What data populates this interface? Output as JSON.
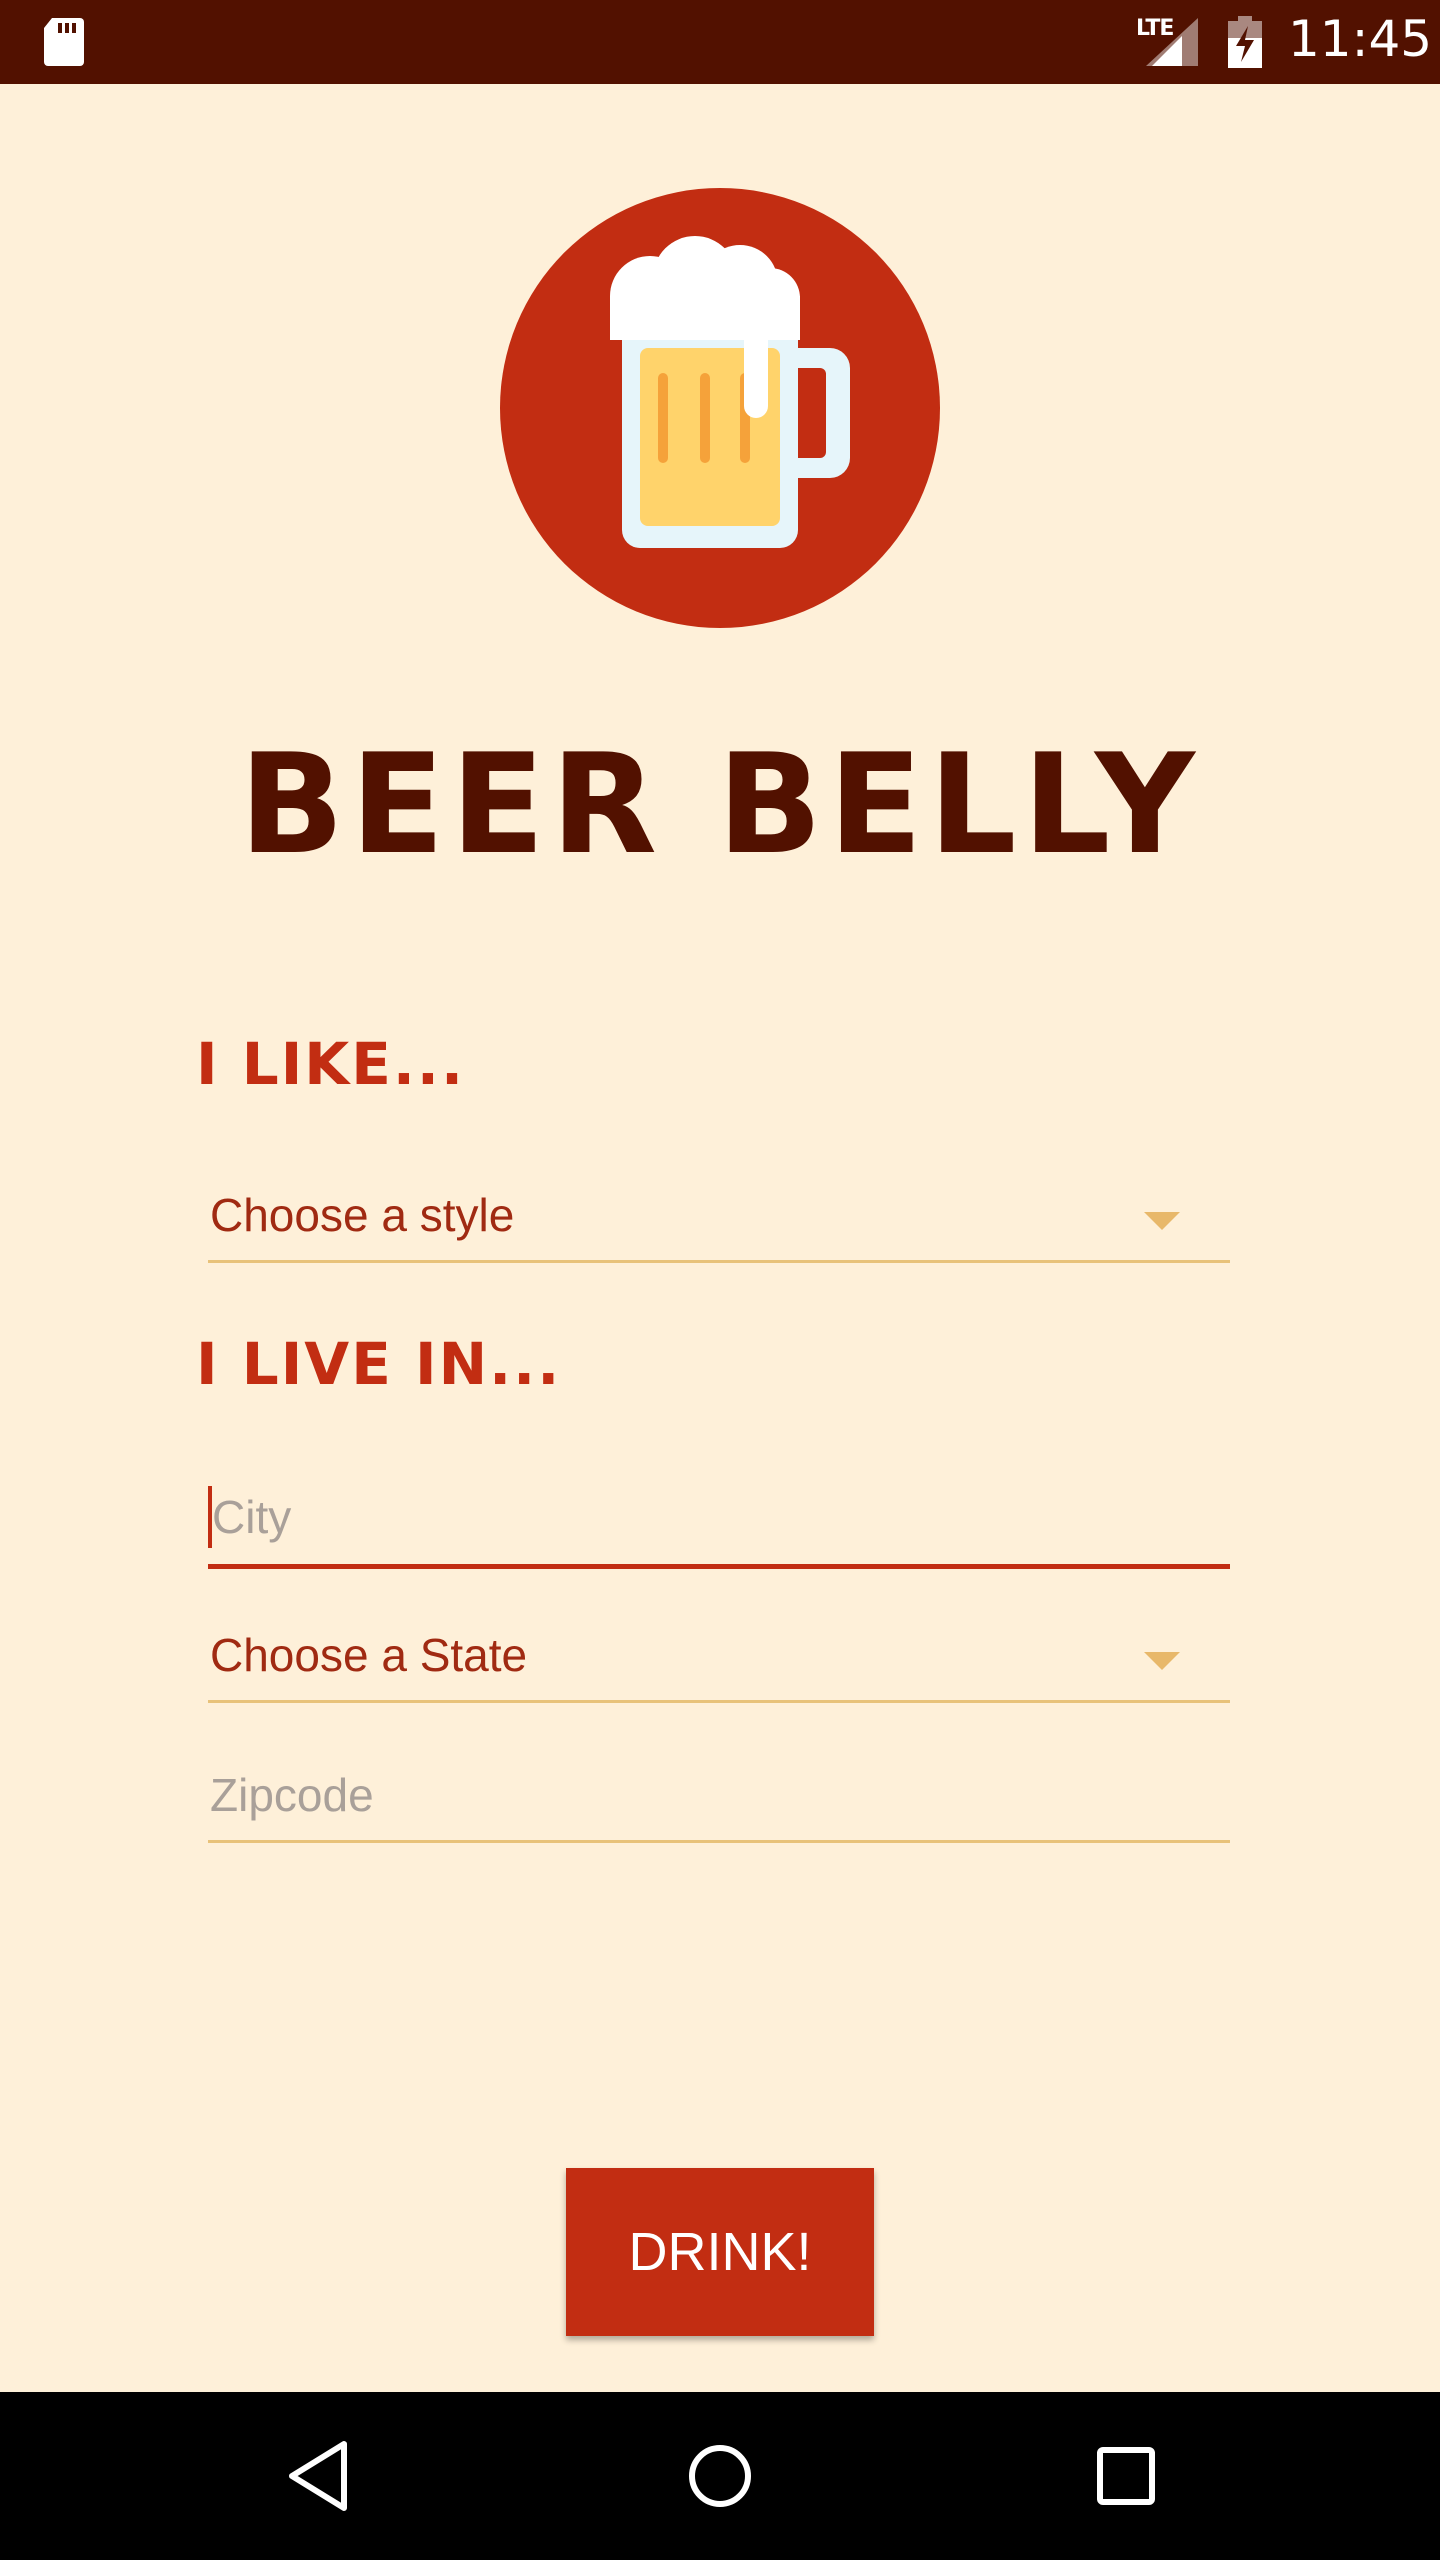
{
  "status_bar": {
    "network": "LTE",
    "time": "11:45",
    "icons": [
      "sd-card-icon",
      "signal-icon",
      "battery-charging-icon"
    ]
  },
  "app": {
    "title": "BEER BELLY",
    "logo": "beer-mug-icon"
  },
  "form": {
    "like_label": "I LIKE...",
    "style_select": "Choose a style",
    "live_label": "I LIVE IN...",
    "city_placeholder": "City",
    "state_select": "Choose a State",
    "zip_placeholder": "Zipcode"
  },
  "actions": {
    "drink_label": "DRINK!"
  },
  "nav_bar": {
    "icons": [
      "back-icon",
      "home-icon",
      "recents-icon"
    ]
  },
  "colors": {
    "background": "#FEF0D9",
    "status_bar": "#521100",
    "accent": "#C22D12",
    "title": "#521100",
    "underline": "#E8C27A"
  }
}
